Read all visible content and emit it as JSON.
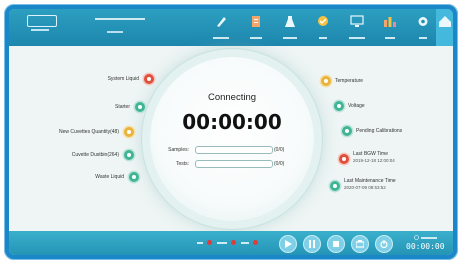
{
  "center": {
    "status": "Connecting",
    "timer": "00:00:00",
    "samples_label": "Samples:",
    "samples_count": "(0/0)",
    "tests_label": "Tests:",
    "tests_count": "(0/0)"
  },
  "left_items": [
    {
      "label": "System Liquid",
      "status": "red"
    },
    {
      "label": "Starter",
      "status": "green"
    },
    {
      "label": "New Cuvettes Quantity(48)",
      "status": "yellow"
    },
    {
      "label": "Cuvette Dustbin(264)",
      "status": "green"
    },
    {
      "label": "Waste Liquid",
      "status": "green"
    }
  ],
  "right_items": [
    {
      "label": "Temperature",
      "status": "yellow"
    },
    {
      "label": "Voltage",
      "status": "green"
    },
    {
      "label": "Pending Calibrations",
      "status": "green"
    },
    {
      "label": "Last BGW Time",
      "sub": "2019-12-18 12:00:04",
      "status": "red"
    },
    {
      "label": "Last Maintenance Time",
      "sub": "2020-07-09 08:53:52",
      "status": "green"
    }
  ],
  "bottom": {
    "stopwatch": "00:00:00"
  },
  "colors": {
    "red": "#e0503c",
    "green": "#40b596",
    "yellow": "#e9b43b",
    "accent": "#1a88c8"
  }
}
